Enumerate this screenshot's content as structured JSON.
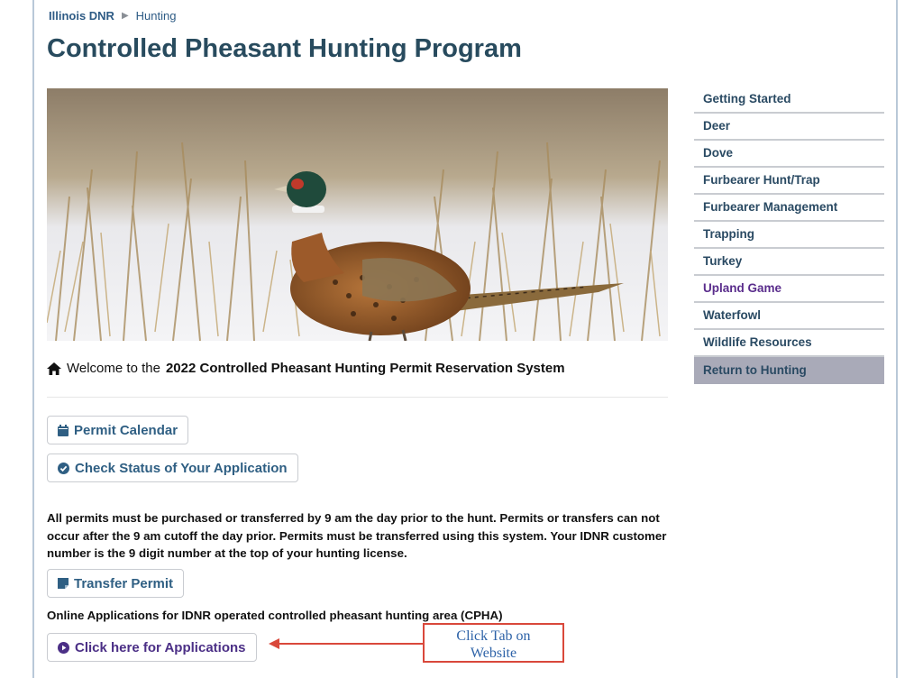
{
  "breadcrumb": {
    "home": "Illinois DNR",
    "current": "Hunting"
  },
  "page": {
    "title": "Controlled Pheasant Hunting Program"
  },
  "welcome": {
    "prefix": "Welcome to the",
    "system_name": "2022 Controlled Pheasant Hunting Permit Reservation System"
  },
  "buttons": {
    "permit_calendar": "Permit Calendar",
    "check_status": "Check Status of Your Application",
    "transfer_permit": "Transfer Permit",
    "applications": "Click here for Applications"
  },
  "notice": "All permits must be purchased or transferred by 9 am the day prior to the hunt. Permits or transfers can not occur after the 9 am cutoff the day prior. Permits must be transferred using this system. Your IDNR customer number is the 9 digit number at the top of your hunting license.",
  "online_applications": "Online Applications for IDNR operated controlled pheasant hunting area (CPHA)",
  "sidebar": {
    "items": [
      {
        "label": "Getting Started"
      },
      {
        "label": "Deer"
      },
      {
        "label": "Dove"
      },
      {
        "label": "Furbearer Hunt/Trap"
      },
      {
        "label": "Furbearer Management"
      },
      {
        "label": "Trapping"
      },
      {
        "label": "Turkey"
      },
      {
        "label": "Upland Game"
      },
      {
        "label": "Waterfowl"
      },
      {
        "label": "Wildlife Resources"
      },
      {
        "label": "Return to Hunting"
      }
    ]
  },
  "annotation": {
    "line1": "Click Tab on",
    "line2": "Website"
  },
  "colors": {
    "heading": "#284b5e",
    "link": "#2f5f83",
    "visited": "#5a2d8c",
    "callout_border": "#d9483b",
    "callout_text": "#2e63a8"
  }
}
